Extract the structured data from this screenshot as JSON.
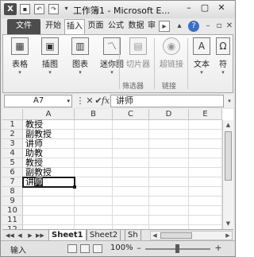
{
  "titlebar": {
    "app_icon": "X",
    "title": "工作簿1 - Microsoft E...",
    "controls": [
      "▴",
      "?",
      "–",
      "▢",
      "✕"
    ]
  },
  "ribbon_tabs": {
    "file": "文件",
    "tabs": [
      "开始",
      "插入",
      "页面",
      "公式",
      "数据",
      "审"
    ],
    "active": "插入"
  },
  "ribbon": {
    "buttons": [
      {
        "label": "表格",
        "icon": "table-icon"
      },
      {
        "label": "插图",
        "icon": "picture-icon"
      },
      {
        "label": "图表",
        "icon": "chart-icon"
      },
      {
        "label": "迷你图",
        "icon": "sparkline-icon"
      },
      {
        "label": "切片器",
        "icon": "slicer-icon"
      },
      {
        "label": "超链接",
        "icon": "hyperlink-icon"
      },
      {
        "label": "文本",
        "icon": "text-icon"
      },
      {
        "label": "符",
        "icon": "symbol-icon"
      }
    ],
    "groups": [
      "筛选器",
      "链接"
    ]
  },
  "formula_bar": {
    "name_box": "A7",
    "fx": "fx",
    "cancel": "✕",
    "enter": "✔",
    "formula": "讲师"
  },
  "grid": {
    "columns": [
      "A",
      "B",
      "C",
      "D",
      "E"
    ],
    "rows": [
      "1",
      "2",
      "3",
      "4",
      "5",
      "6",
      "7",
      "8",
      "9",
      "10",
      "11",
      "12"
    ],
    "cells": {
      "A1": "教授",
      "A2": "副教授",
      "A3": "讲师",
      "A4": "助教",
      "A5": "教授",
      "A6": "副教授",
      "A7_part1": "讲",
      "A7_part2": "师"
    },
    "active_cell": "A7"
  },
  "sheets": {
    "tabs": [
      "Sheet1",
      "Sheet2",
      "Sh"
    ],
    "active": "Sheet1",
    "nav": [
      "◀◀",
      "◀",
      "▶",
      "▶▶"
    ]
  },
  "status": {
    "mode": "输入",
    "zoom": "100%",
    "zoom_minus": "–",
    "zoom_plus": "+"
  },
  "colors": {
    "accent_dark": "#4d4d4d",
    "selection": "#1a1a1a"
  }
}
